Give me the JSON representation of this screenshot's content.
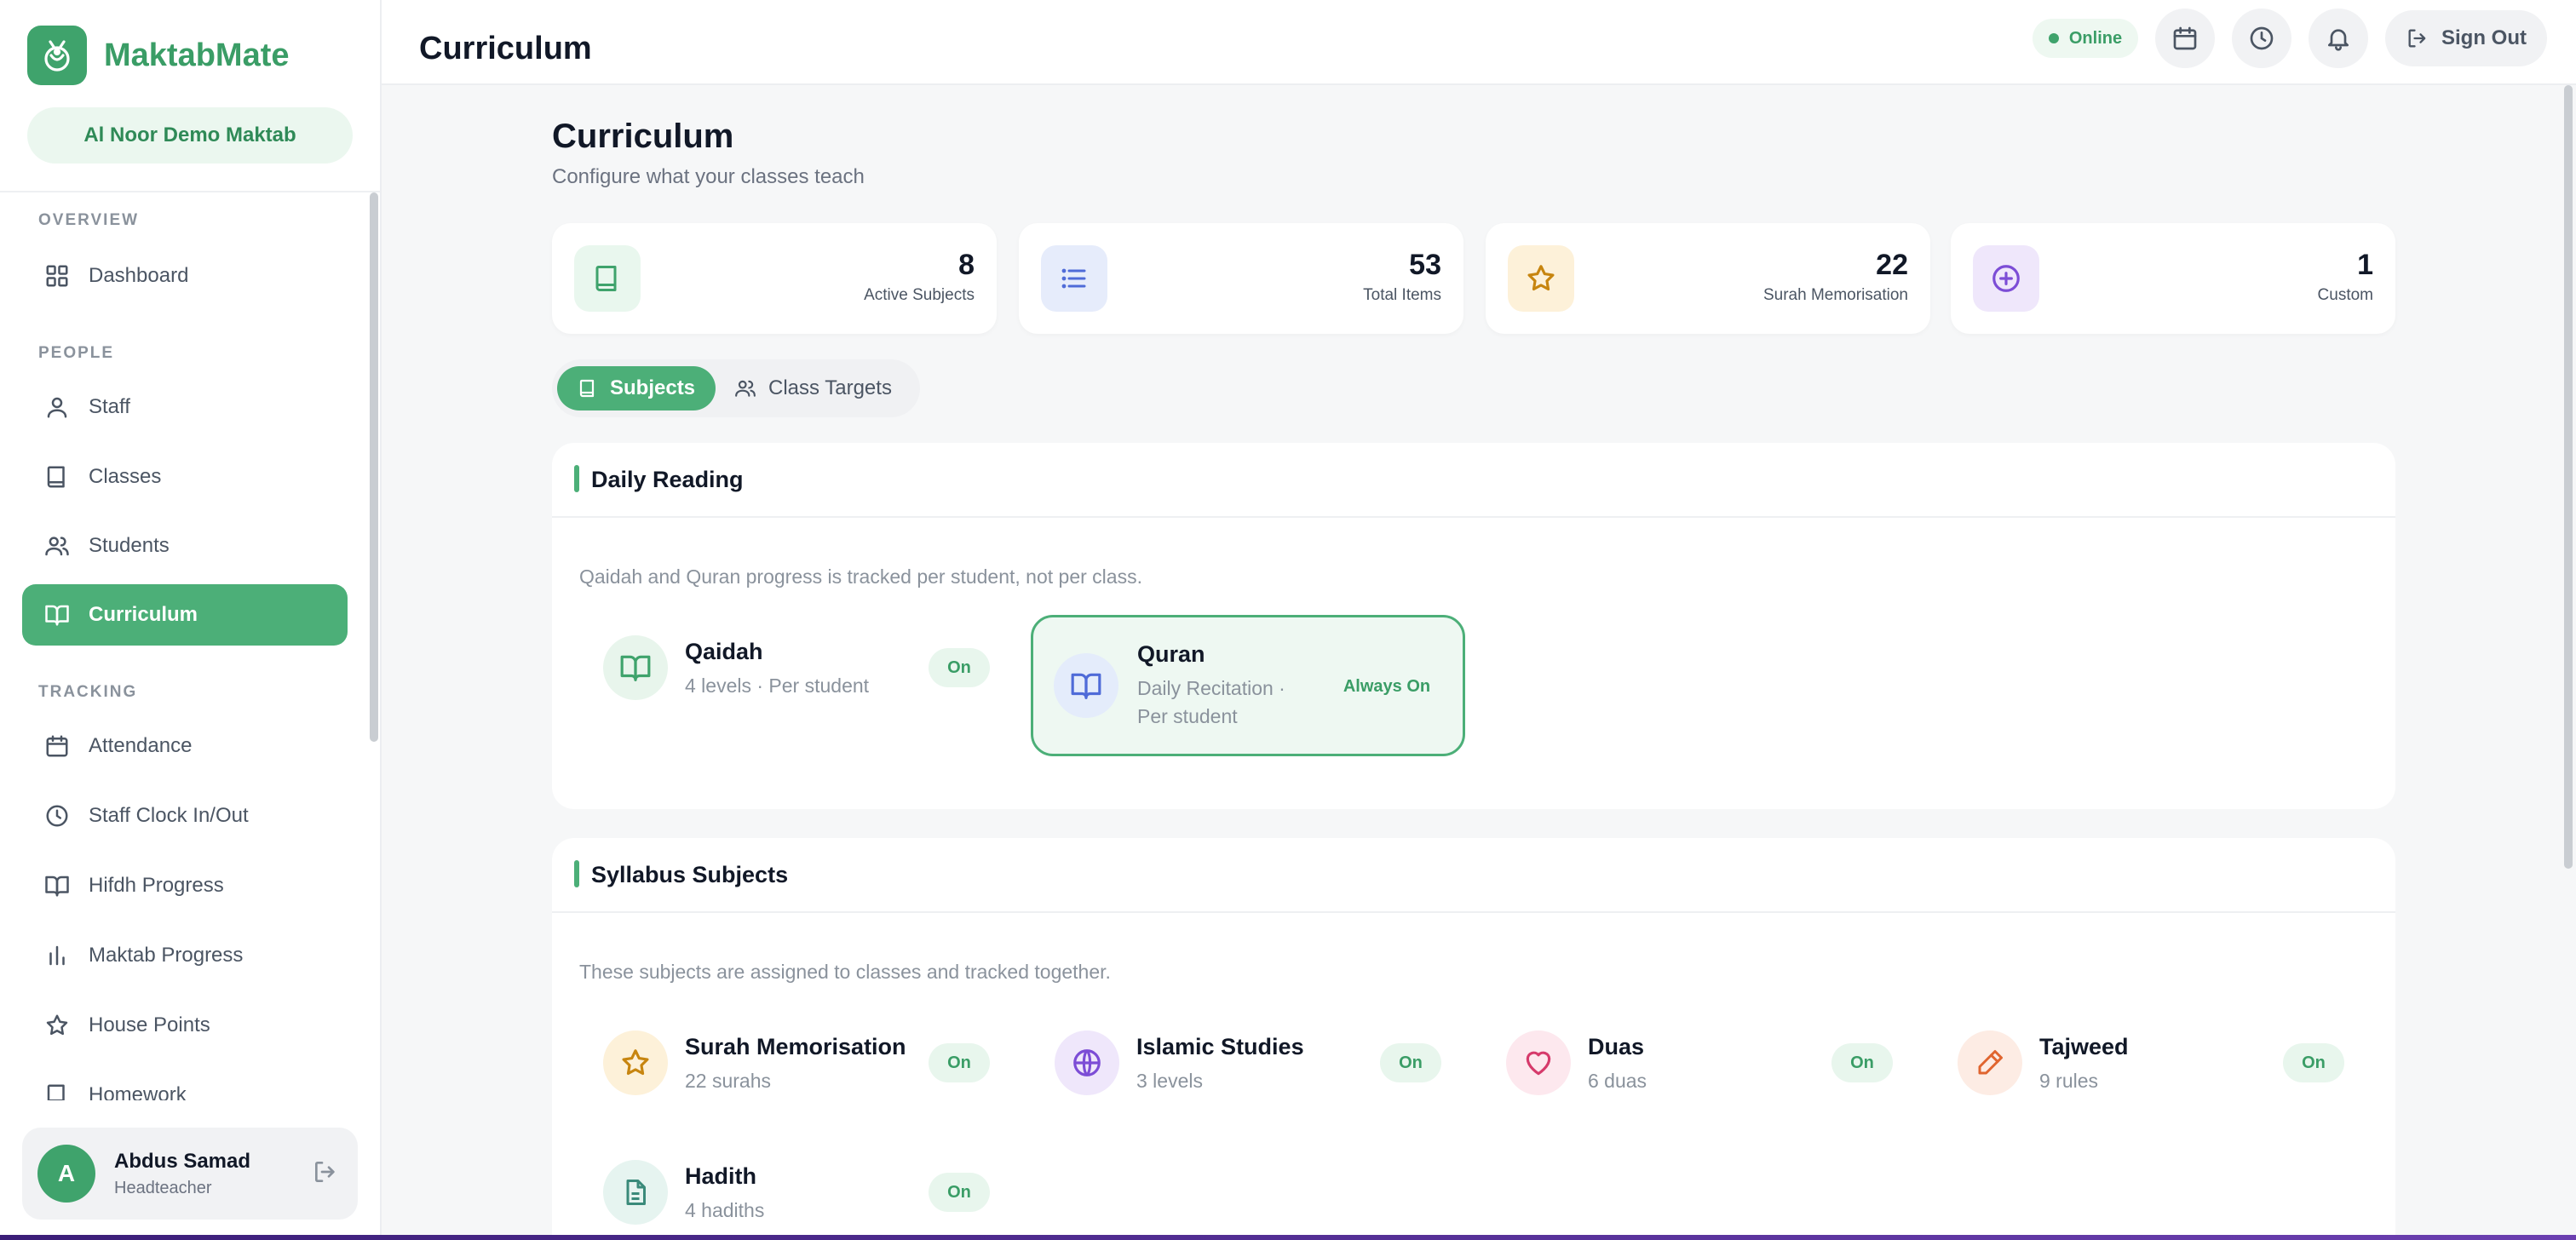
{
  "brand": {
    "name": "MaktabMate",
    "school": "Al Noor Demo Maktab"
  },
  "sidebar": {
    "sections": {
      "overview": "OVERVIEW",
      "people": "PEOPLE",
      "tracking": "TRACKING"
    },
    "items": [
      {
        "label": "Dashboard",
        "icon": "dashboard-grid-icon"
      },
      {
        "label": "Staff",
        "icon": "user-icon"
      },
      {
        "label": "Classes",
        "icon": "book-icon"
      },
      {
        "label": "Students",
        "icon": "users-icon"
      },
      {
        "label": "Curriculum",
        "icon": "open-book-icon",
        "active": true
      },
      {
        "label": "Attendance",
        "icon": "calendar-icon"
      },
      {
        "label": "Staff Clock In/Out",
        "icon": "clock-icon"
      },
      {
        "label": "Hifdh Progress",
        "icon": "open-book-icon"
      },
      {
        "label": "Maktab Progress",
        "icon": "bar-chart-icon"
      },
      {
        "label": "House Points",
        "icon": "star-icon"
      },
      {
        "label": "Homework",
        "icon": "book-icon"
      }
    ],
    "user": {
      "initial": "A",
      "name": "Abdus Samad",
      "role": "Headteacher"
    }
  },
  "header": {
    "title": "Curriculum",
    "status": "Online",
    "sign_out": "Sign Out"
  },
  "page": {
    "title": "Curriculum",
    "subtitle": "Configure what your classes teach"
  },
  "stats": [
    {
      "value": "8",
      "label": "Active Subjects",
      "icon": "book-icon",
      "color": "#3fa36c"
    },
    {
      "value": "53",
      "label": "Total Items",
      "icon": "list-icon",
      "color": "#4f6bd8"
    },
    {
      "value": "22",
      "label": "Surah Memorisation",
      "icon": "star-icon",
      "color": "#c7850f"
    },
    {
      "value": "1",
      "label": "Custom",
      "icon": "plus-circle-icon",
      "color": "#7c4dd6"
    }
  ],
  "tabs": [
    {
      "label": "Subjects",
      "active": true
    },
    {
      "label": "Class Targets",
      "active": false
    }
  ],
  "daily_reading": {
    "title": "Daily Reading",
    "description": "Qaidah and Quran progress is tracked per student, not per class.",
    "items": [
      {
        "name": "Qaidah",
        "meta": "4 levels · Per student",
        "status": "On"
      },
      {
        "name": "Quran",
        "meta_line1": "Daily Recitation ·",
        "meta_line2": "Per student",
        "status": "Always On"
      }
    ]
  },
  "syllabus": {
    "title": "Syllabus Subjects",
    "description": "These subjects are assigned to classes and tracked together.",
    "items": [
      {
        "name": "Surah Memorisation",
        "meta": "22 surahs",
        "status": "On",
        "icon": "star-icon"
      },
      {
        "name": "Islamic Studies",
        "meta": "3 levels",
        "status": "On",
        "icon": "globe-icon"
      },
      {
        "name": "Duas",
        "meta": "6 duas",
        "status": "On",
        "icon": "heart-icon"
      },
      {
        "name": "Tajweed",
        "meta": "9 rules",
        "status": "On",
        "icon": "pen-icon"
      },
      {
        "name": "Hadith",
        "meta": "4 hadiths",
        "status": "On",
        "icon": "document-icon"
      }
    ]
  },
  "colors": {
    "accent": "#4caf78",
    "brand_text": "#3a9d66",
    "active_nav": "#4caf78"
  }
}
